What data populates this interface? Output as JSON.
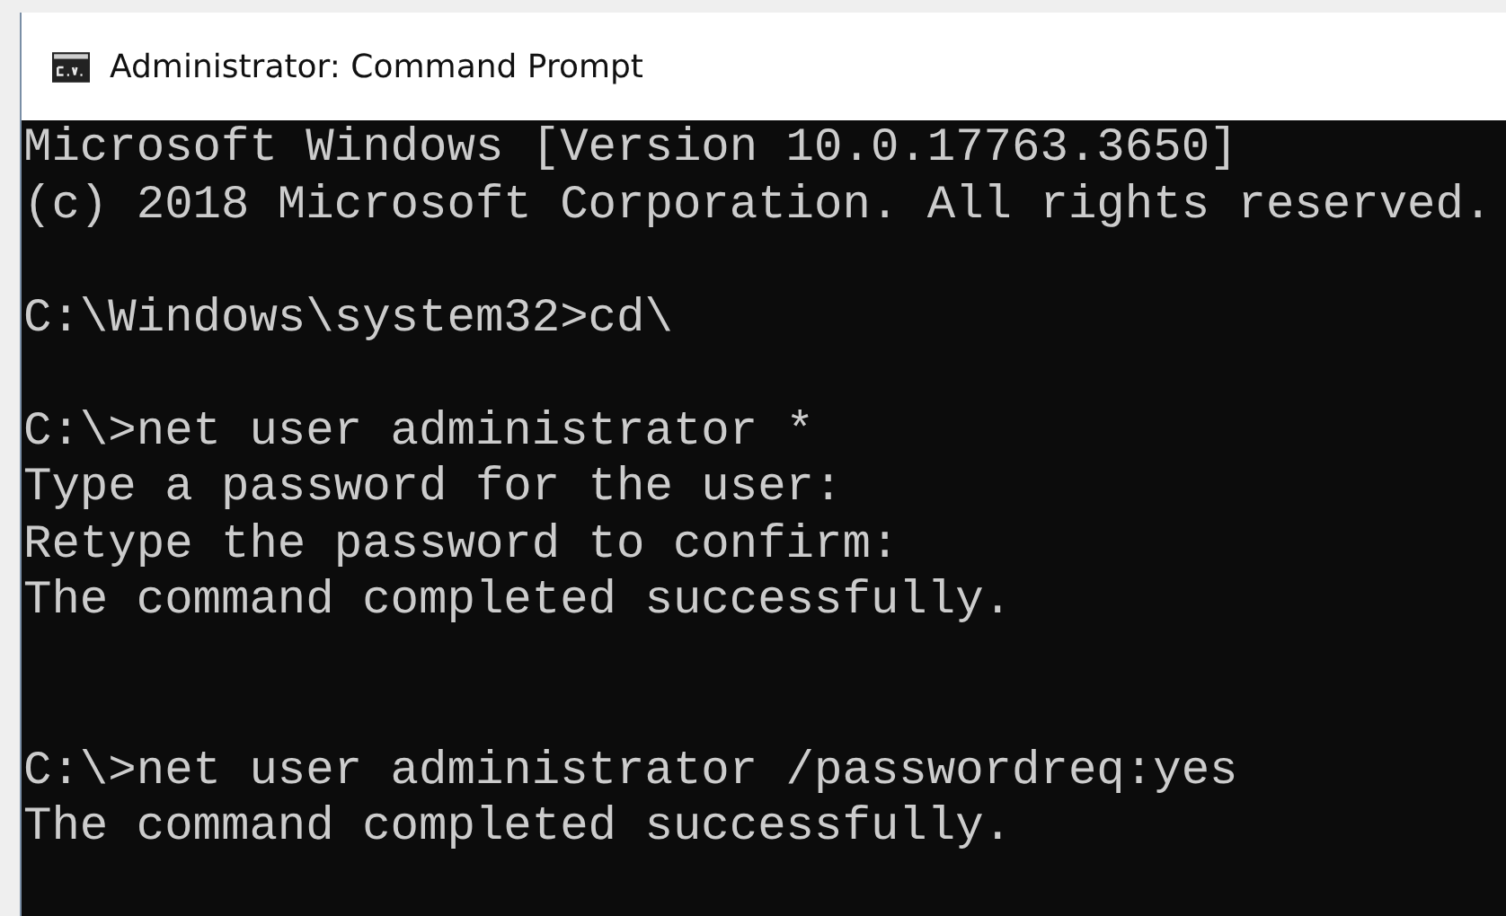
{
  "window": {
    "title": "Administrator: Command Prompt"
  },
  "console": {
    "blocks": [
      {
        "extra_gap": false,
        "lines": [
          "Microsoft Windows [Version 10.0.17763.3650]",
          "(c) 2018 Microsoft Corporation. All rights reserved."
        ]
      },
      {
        "extra_gap": false,
        "lines": [
          "C:\\Windows\\system32>cd\\"
        ]
      },
      {
        "extra_gap": false,
        "lines": [
          "C:\\>net user administrator *",
          "Type a password for the user:",
          "Retype the password to confirm:",
          "The command completed successfully."
        ]
      },
      {
        "extra_gap": true,
        "lines": [
          "C:\\>net user administrator /passwordreq:yes",
          "The command completed successfully."
        ]
      }
    ]
  }
}
